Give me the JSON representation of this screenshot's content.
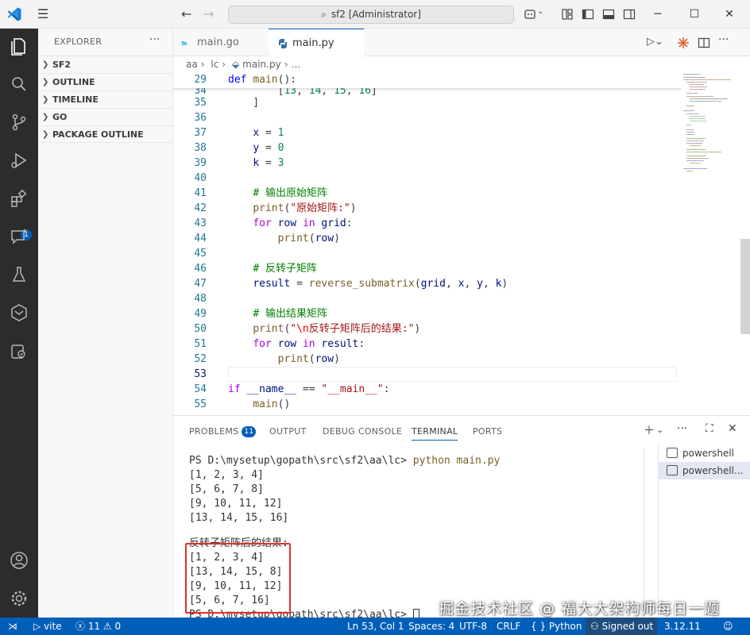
{
  "window": {
    "title": "sf2 [Administrator]"
  },
  "sidebar": {
    "title": "EXPLORER",
    "sections": [
      "SF2",
      "OUTLINE",
      "TIMELINE",
      "GO",
      "PACKAGE OUTLINE"
    ]
  },
  "activity": {
    "extensions_badge": "1"
  },
  "tabs": [
    {
      "label": "main.go",
      "icon": "go-file-icon"
    },
    {
      "label": "main.py",
      "icon": "python-file-icon"
    }
  ],
  "breadcrumb": [
    "aa",
    "lc",
    "main.py"
  ],
  "sticky_line": {
    "num": "29",
    "text": "def main():"
  },
  "panel": {
    "tabs": [
      "PROBLEMS",
      "OUTPUT",
      "DEBUG CONSOLE",
      "TERMINAL",
      "PORTS"
    ],
    "problems_badge": "11",
    "terminals": [
      "powershell",
      "powershell..."
    ]
  },
  "terminal_lines": [
    "PS D:\\mysetup\\gopath\\src\\sf2\\aa\\lc> ",
    "[1, 2, 3, 4]",
    "[5, 6, 7, 8]",
    "[9, 10, 11, 12]",
    "[13, 14, 15, 16]",
    "",
    "反转子矩阵后的结果:",
    "[1, 2, 3, 4]",
    "[13, 14, 15, 8]",
    "[9, 10, 11, 12]",
    "[5, 6, 7, 16]",
    "PS D:\\mysetup\\gopath\\src\\sf2\\aa\\lc> "
  ],
  "terminal_command": "python main.py",
  "watermark": "掘金技术社区 @ 福大大架构师每日一题",
  "status": {
    "branch": "vite",
    "errors": "11",
    "warnings": "0",
    "position": "Ln 53, Col 1",
    "spaces": "Spaces: 4",
    "encoding": "UTF-8",
    "eol": "CRLF",
    "language": "Python",
    "account": "Signed out",
    "python_version": "3.12.11"
  },
  "colors": {
    "accent": "#005fb8",
    "status_bar": "#005fb8",
    "activity_bar": "#2c2c2c",
    "highlight_box": "#e03030"
  }
}
